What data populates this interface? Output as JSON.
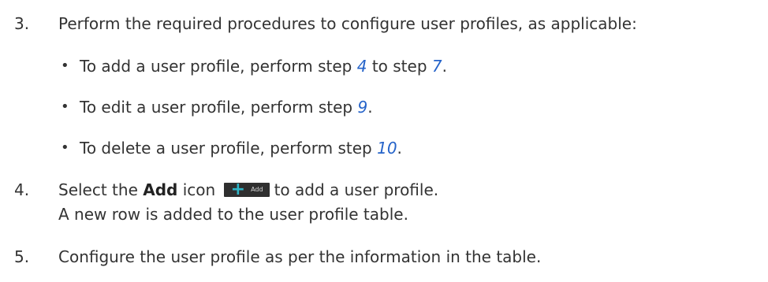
{
  "steps": {
    "step3": {
      "number": "3.",
      "text": "Perform the required procedures to configure user profiles, as applicable:",
      "bullets": [
        {
          "pre": "To add a user profile, perform step ",
          "link1": "4",
          "mid": " to step ",
          "link2": "7",
          "post": "."
        },
        {
          "pre": "To edit a user profile, perform step ",
          "link1": "9",
          "post": "."
        },
        {
          "pre": "To delete a user profile, perform step ",
          "link1": "10",
          "post": "."
        }
      ]
    },
    "step4": {
      "number": "4.",
      "pre": "Select the ",
      "bold": "Add",
      "mid": " icon",
      "icon_label": "Add",
      "post": "to add a user profile.",
      "result": "A new row is added to the user profile table."
    },
    "step5": {
      "number": "5.",
      "text": "Configure the user profile as per the information in the table."
    }
  },
  "colors": {
    "text": "#333333",
    "link": "#2563c9",
    "icon_bg": "#2f2f2f",
    "icon_plus": "#2fb6c8"
  },
  "icons": {
    "bullet": "bullet-dot",
    "add": "plus-add-icon"
  }
}
